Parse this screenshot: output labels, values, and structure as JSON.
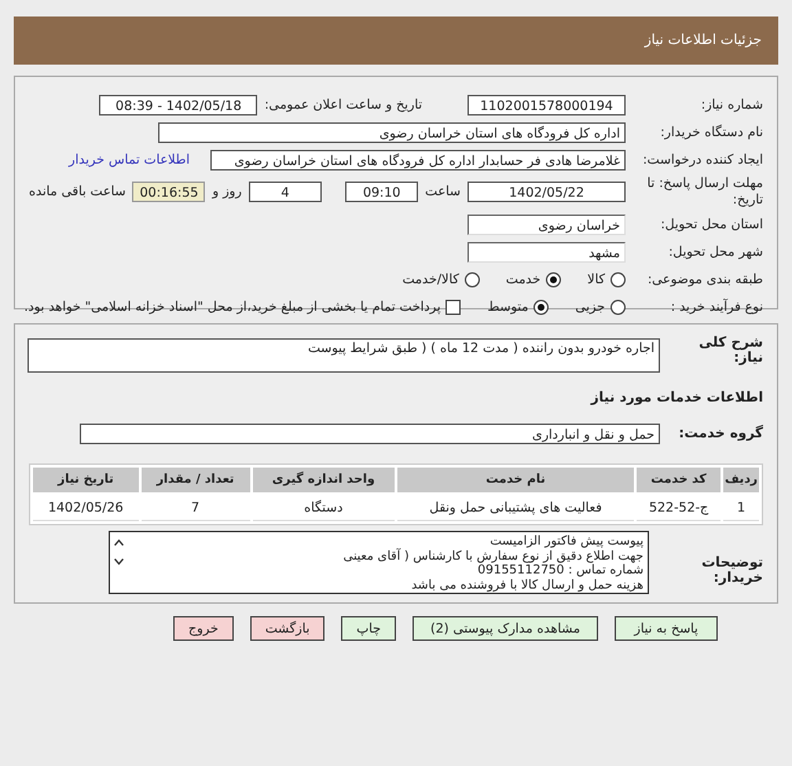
{
  "header": {
    "title": "جزئیات اطلاعات نیاز"
  },
  "need": {
    "number_label": "شماره نیاز:",
    "number": "1102001578000194",
    "announce_label": "تاریخ و ساعت اعلان عمومی:",
    "announce": "1402/05/18 - 08:39"
  },
  "buyer": {
    "label": "نام دستگاه خریدار:",
    "value": "اداره کل فرودگاه های استان خراسان رضوی"
  },
  "requester": {
    "label": "ایجاد کننده درخواست:",
    "value": "غلامرضا هادی فر حسابدار اداره کل فرودگاه های استان خراسان رضوی",
    "contact_link": "اطلاعات تماس خریدار"
  },
  "deadline": {
    "label": "مهلت ارسال پاسخ: تا تاریخ:",
    "date": "1402/05/22",
    "time_label": "ساعت",
    "time": "09:10",
    "days": "4",
    "days_label": "روز و",
    "remaining": "00:16:55",
    "remaining_label": "ساعت باقی مانده"
  },
  "province": {
    "label": "استان محل تحویل:",
    "value": "خراسان رضوی"
  },
  "city": {
    "label": "شهر محل تحویل:",
    "value": "مشهد"
  },
  "category": {
    "label": "طبقه بندی موضوعی:",
    "options": [
      {
        "label": "کالا",
        "selected": false
      },
      {
        "label": "خدمت",
        "selected": true
      },
      {
        "label": "کالا/خدمت",
        "selected": false
      }
    ]
  },
  "process": {
    "label": "نوع فرآیند خرید :",
    "options": [
      {
        "label": "جزیی",
        "selected": false
      },
      {
        "label": "متوسط",
        "selected": true
      }
    ],
    "payment": {
      "checked": false,
      "text": "پرداخت تمام یا بخشی از مبلغ خرید،از محل \"اسناد خزانه اسلامی\" خواهد بود."
    }
  },
  "summary": {
    "label": "شرح کلی نیاز:",
    "value": "اجاره خودرو بدون راننده ( مدت 12 ماه ) ( طبق شرایط پیوست"
  },
  "services_title": "اطلاعات خدمات مورد نیاز",
  "service_group": {
    "label": "گروه خدمت:",
    "value": "حمل و نقل و انبارداری"
  },
  "table": {
    "columns": [
      "ردیف",
      "کد خدمت",
      "نام خدمت",
      "واحد اندازه گیری",
      "تعداد / مقدار",
      "تاریخ نیاز"
    ],
    "rows": [
      [
        "1",
        "ج-52-522",
        "فعالیت های پشتیبانی حمل ونقل",
        "دستگاه",
        "7",
        "1402/05/26"
      ]
    ]
  },
  "notes": {
    "label": "توضیحات خریدار:",
    "lines": [
      "پیوست پیش فاکتور الزامیست",
      "جهت اطلاع دقیق از نوع سفارش با کارشناس ( آقای معینی",
      "شماره تماس :  09155112750",
      "هزینه حمل و ارسال کالا با فروشنده می باشد"
    ]
  },
  "buttons": [
    {
      "label": "پاسخ به نیاز",
      "kind": "normal"
    },
    {
      "label": "مشاهده مدارک پیوستی (2)",
      "kind": "normal"
    },
    {
      "label": "چاپ",
      "kind": "normal"
    },
    {
      "label": "بازگشت",
      "kind": "exit"
    },
    {
      "label": "خروج",
      "kind": "exit"
    }
  ]
}
